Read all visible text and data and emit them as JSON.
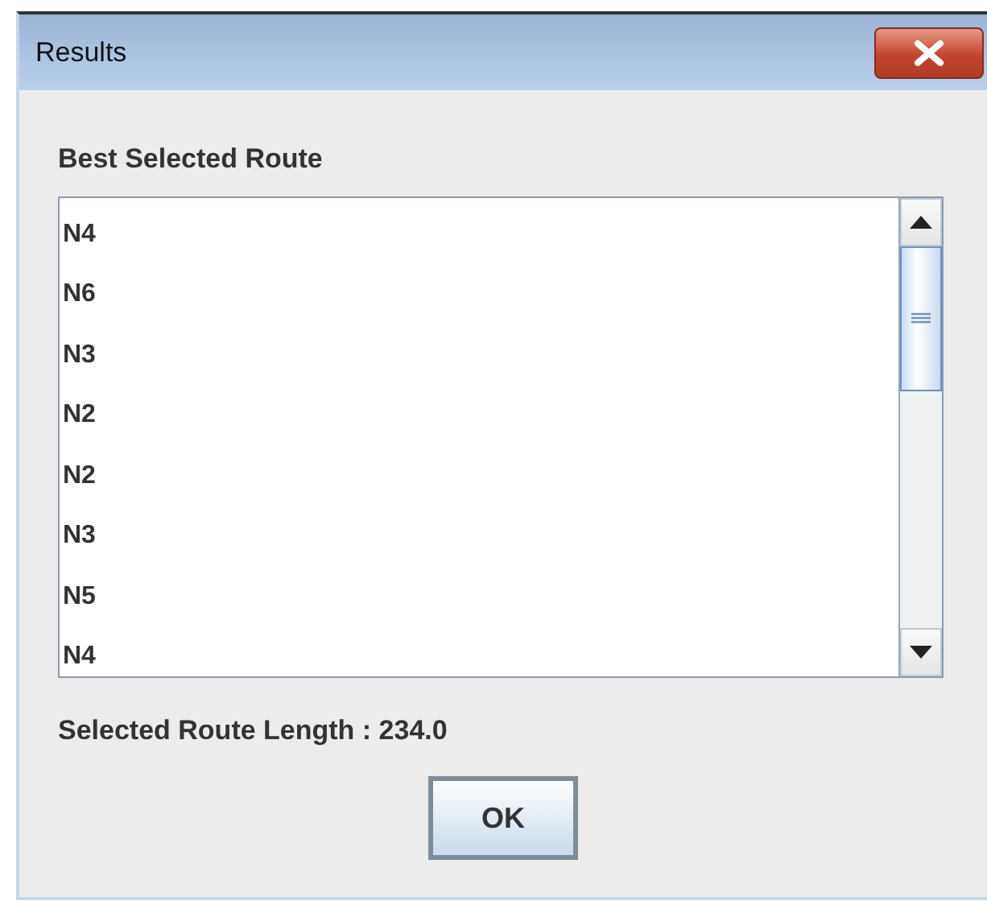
{
  "window": {
    "title": "Results"
  },
  "route_label": "Best Selected Route",
  "route_nodes": [
    "N4",
    "N6",
    "N3",
    "N2",
    "N2",
    "N3",
    "N5",
    "N4"
  ],
  "length_label": "Selected Route Length : 234.0",
  "buttons": [
    "OK"
  ]
}
